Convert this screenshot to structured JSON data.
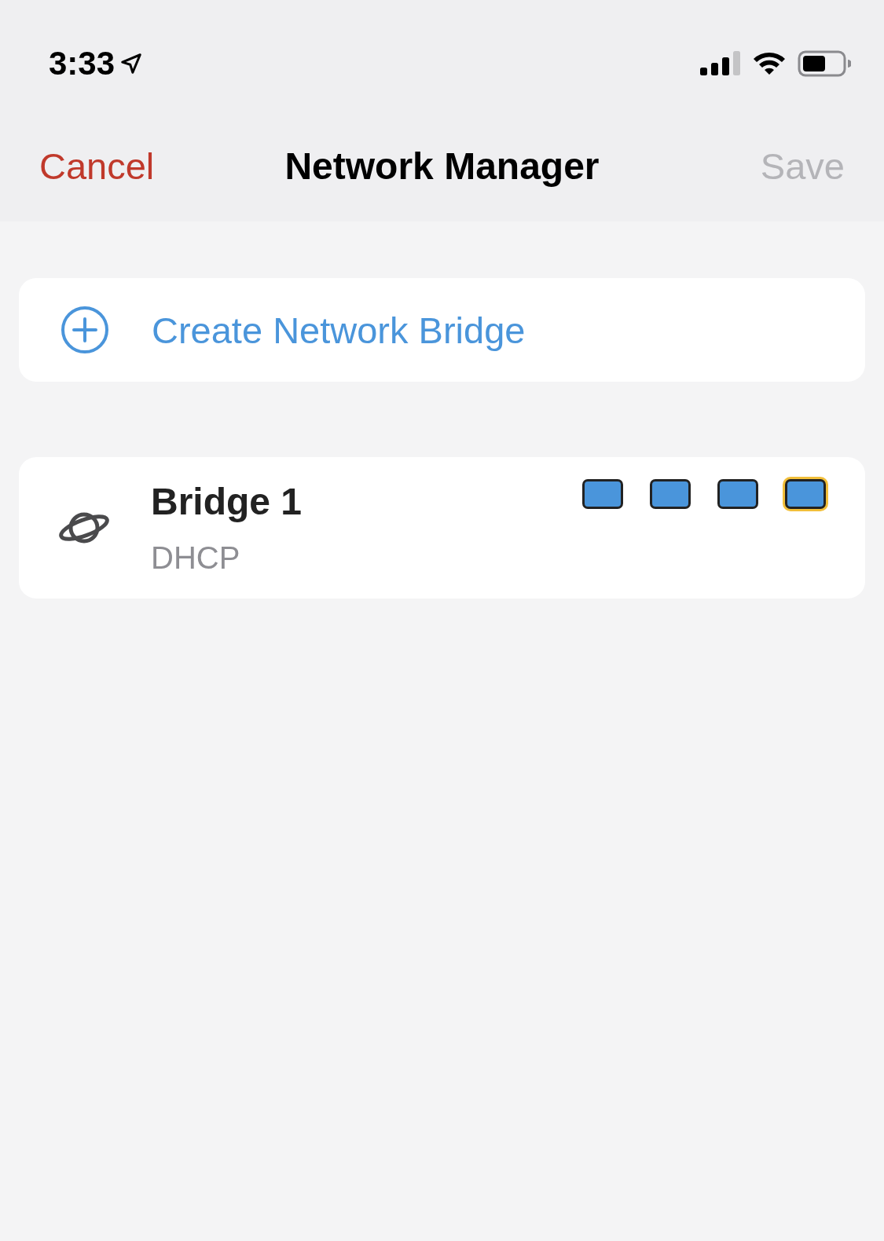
{
  "status_bar": {
    "time": "3:33"
  },
  "nav": {
    "cancel": "Cancel",
    "title": "Network Manager",
    "save": {
      "label": "Save",
      "disabled": true
    }
  },
  "create_action": {
    "label": "Create Network Bridge"
  },
  "bridges": [
    {
      "name": "Bridge 1",
      "mode": "DHCP",
      "ports": [
        {
          "selected": false
        },
        {
          "selected": false
        },
        {
          "selected": false
        },
        {
          "selected": true
        }
      ]
    }
  ]
}
